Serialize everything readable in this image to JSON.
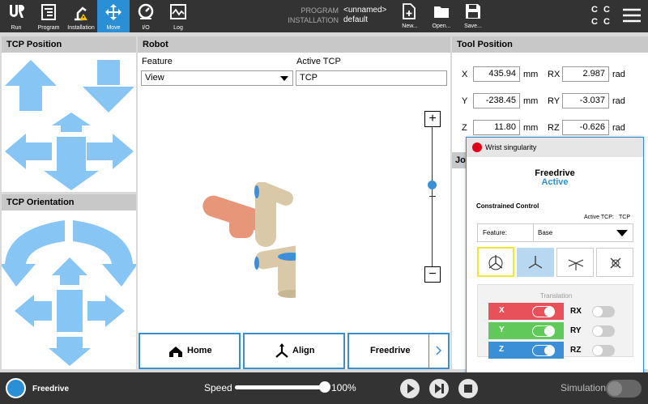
{
  "nav": [
    {
      "label": "Run",
      "icon": "ur-logo-icon"
    },
    {
      "label": "Program",
      "icon": "program-icon"
    },
    {
      "label": "Installation",
      "icon": "installation-icon"
    },
    {
      "label": "Move",
      "icon": "move-icon",
      "active": true
    },
    {
      "label": "I/O",
      "icon": "io-icon"
    },
    {
      "label": "Log",
      "icon": "log-icon"
    }
  ],
  "header": {
    "program_label": "PROGRAM",
    "program_value": "<unnamed>",
    "installation_label": "INSTALLATION",
    "installation_value": "default",
    "new_label": "New...",
    "open_label": "Open...",
    "save_label": "Save...",
    "cc_line1": "C C",
    "cc_line2": "C C"
  },
  "tcp_position": {
    "title": "TCP Position"
  },
  "tcp_orientation": {
    "title": "TCP Orientation"
  },
  "robot": {
    "title": "Robot",
    "feature_label": "Feature",
    "feature_value": "View",
    "active_tcp_label": "Active TCP",
    "active_tcp_value": "TCP",
    "zoom_in": "+",
    "zoom_out": "−",
    "home_label": "Home",
    "align_label": "Align",
    "freedrive_label": "Freedrive"
  },
  "tool_position": {
    "title": "Tool Position",
    "rows": [
      {
        "axis": "X",
        "value": "435.94",
        "unit": "mm",
        "raxis": "RX",
        "rvalue": "2.987",
        "runit": "rad"
      },
      {
        "axis": "Y",
        "value": "-238.45",
        "unit": "mm",
        "raxis": "RY",
        "rvalue": "-3.037",
        "runit": "rad"
      },
      {
        "axis": "Z",
        "value": "11.80",
        "unit": "mm",
        "raxis": "RZ",
        "rvalue": "-0.626",
        "runit": "rad"
      }
    ],
    "joint_tab": "Joi"
  },
  "freedrive_popup": {
    "warning": "Wrist singularity",
    "title": "Freedrive",
    "status": "Active",
    "constrained_label": "Constrained Control",
    "active_tcp_label": "Active TCP:",
    "active_tcp_value": "TCP",
    "feature_label": "Feature:",
    "feature_value": "Base",
    "translation_label": "Translation",
    "axes": [
      {
        "label": "X",
        "on": true
      },
      {
        "label": "Y",
        "on": true
      },
      {
        "label": "Z",
        "on": true
      }
    ],
    "rot_axes": [
      {
        "label": "RX",
        "on": false
      },
      {
        "label": "RY",
        "on": false
      },
      {
        "label": "RZ",
        "on": false
      }
    ],
    "colors": {
      "x": "#e8515a",
      "y": "#61c95a",
      "z": "#3b8fd4",
      "accent": "#2b8fd6",
      "warning": "#e0001b"
    }
  },
  "bottom": {
    "freedrive_label": "Freedrive",
    "speed_label": "Speed",
    "speed_value": "100%",
    "speed_fraction": 1.0,
    "simulation_label": "Simulation"
  }
}
